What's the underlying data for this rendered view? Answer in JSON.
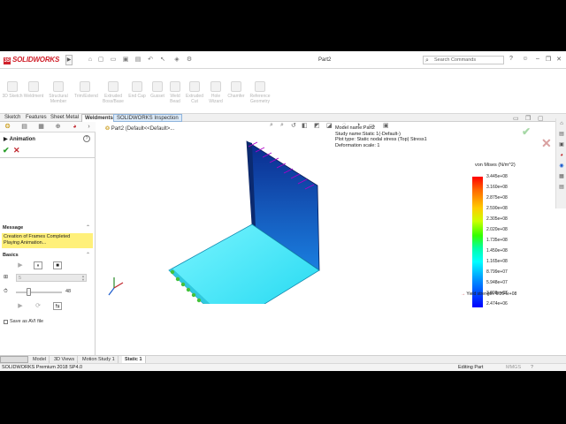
{
  "app": {
    "brand": "SOLIDWORKS",
    "doc_title": "Part2",
    "search_placeholder": "Search Commands"
  },
  "toolbar": {
    "commands": [
      {
        "label": "3D Sketch"
      },
      {
        "label": "Weldment"
      },
      {
        "label": "Structural Member"
      },
      {
        "label": "Trim/Extend"
      },
      {
        "label": "Extruded Boss/Base"
      },
      {
        "label": "End Cap"
      },
      {
        "label": "Gusset"
      },
      {
        "label": "Weld Bead"
      },
      {
        "label": "Extruded Cut"
      },
      {
        "label": "Hole Wizard"
      },
      {
        "label": "Chamfer"
      },
      {
        "label": "Reference Geometry"
      }
    ]
  },
  "tabs": [
    "Sketch",
    "Features",
    "Sheet Metal",
    "Weldments",
    "SOLIDWORKS Inspection"
  ],
  "panel": {
    "title": "Animation",
    "message_header": "Message",
    "message_lines": [
      "Creation of Frames Completed",
      "Playing Animation..."
    ],
    "basics_header": "Basics",
    "frames_value": "5",
    "speed_value": "48",
    "speed_level": 0.3,
    "save_avi_label": "Save as AVI file"
  },
  "viewport": {
    "tree_label": "Part2  (Default<<Default>...",
    "info": [
      "Model name:Part2",
      "Study name:Static 1(-Default-)",
      "Plot type: Static nodal stress (Top) Stress1",
      "Deformation scale: 1"
    ],
    "legend_title": "von Mises (N/m^2)",
    "legend_ticks": [
      "3.445e+08",
      "3.160e+08",
      "2.875e+08",
      "2.590e+08",
      "2.305e+08",
      "2.020e+08",
      "1.735e+08",
      "1.450e+08",
      "1.165e+08",
      "8.799e+07",
      "5.948e+07",
      "3.098e+07",
      "2.474e+06"
    ],
    "yield_label": "Yield strength: 6.204e+08"
  },
  "bottom_tabs": [
    "Model",
    "3D Views",
    "Motion Study 1",
    "Static 1"
  ],
  "status": {
    "product": "SOLIDWORKS Premium 2018 SP4.0",
    "mode": "Editing Part",
    "units": "MMGS"
  },
  "colors": {
    "brand_red": "#d0202a",
    "message_yellow": "#fff07a",
    "ok_green": "#2a9d2a",
    "cancel_red": "#c0272d"
  }
}
